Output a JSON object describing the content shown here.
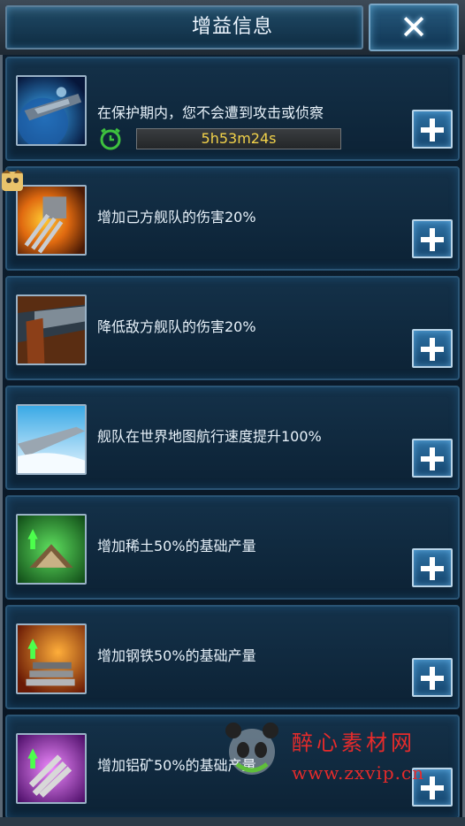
{
  "header": {
    "title": "增益信息",
    "close_label": "✕"
  },
  "buffs": [
    {
      "icon": "shield-protection-icon",
      "text": "在保护期内，您不会遭到攻击或侦察",
      "timer": "5h53m24s"
    },
    {
      "icon": "cannon-damage-icon",
      "text": "增加己方舰队的伤害20%"
    },
    {
      "icon": "armor-defense-icon",
      "text": "降低敌方舰队的伤害20%"
    },
    {
      "icon": "ship-speed-icon",
      "text": "舰队在世界地图航行速度提升100%"
    },
    {
      "icon": "rare-earth-production-icon",
      "text": "增加稀土50%的基础产量"
    },
    {
      "icon": "steel-production-icon",
      "text": "增加钢铁50%的基础产量"
    },
    {
      "icon": "aluminum-production-icon",
      "text": "增加铝矿50%的基础产量"
    }
  ],
  "watermark": {
    "name": "醉心素材网",
    "url": "www.zxvip.cn"
  },
  "colors": {
    "timer_text": "#f2d24a",
    "accent": "#2f73a6",
    "clock_green": "#3ec23e"
  }
}
